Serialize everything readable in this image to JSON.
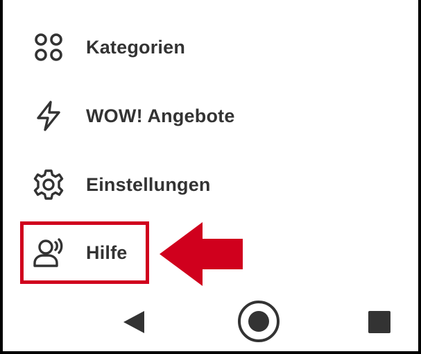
{
  "menu": {
    "items": [
      {
        "label": "Kategorien",
        "icon": "grid-circles-icon"
      },
      {
        "label": "WOW! Angebote",
        "icon": "lightning-icon"
      },
      {
        "label": "Einstellungen",
        "icon": "gear-icon"
      },
      {
        "label": "Hilfe",
        "icon": "support-person-icon"
      }
    ]
  },
  "annotation": {
    "highlight_color": "#d0001d",
    "highlighted_item": "Hilfe"
  },
  "navbar": {
    "buttons": [
      "back-triangle-icon",
      "home-circle-icon",
      "recents-square-icon"
    ]
  },
  "colors": {
    "text": "#333333",
    "background": "#ffffff",
    "accent": "#d0001d"
  }
}
